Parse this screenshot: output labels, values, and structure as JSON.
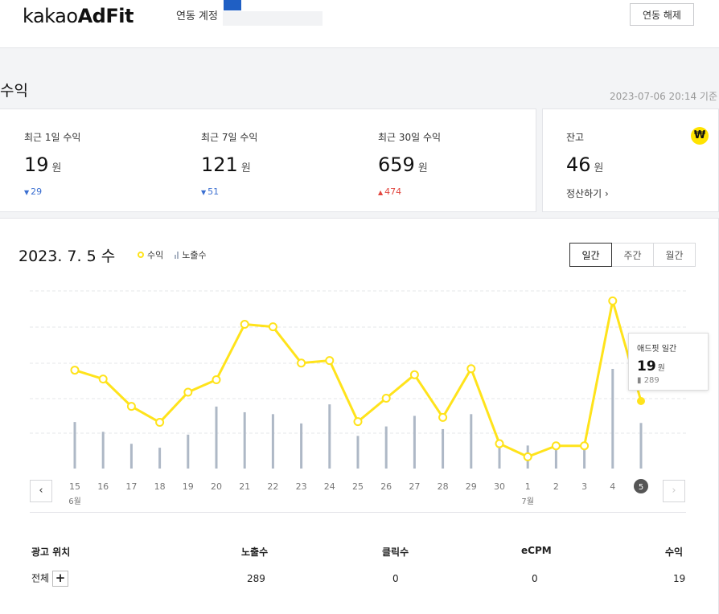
{
  "header": {
    "logo_prefix": "kakao",
    "logo_bold": "AdFit",
    "account_label": "연동 계정",
    "unlink_label": "연동 해제"
  },
  "section": {
    "title": "수익",
    "timestamp": "2023-07-06 20:14 기준"
  },
  "summary": [
    {
      "label": "최근 1일 수익",
      "value": "19",
      "unit": "원",
      "delta": "29",
      "direction": "down"
    },
    {
      "label": "최근 7일 수익",
      "value": "121",
      "unit": "원",
      "delta": "51",
      "direction": "down"
    },
    {
      "label": "최근 30일 수익",
      "value": "659",
      "unit": "원",
      "delta": "474",
      "direction": "up"
    }
  ],
  "balance": {
    "label": "잔고",
    "value": "46",
    "unit": "원",
    "settle_label": "정산하기",
    "badge_glyph": "₩"
  },
  "chart_header": {
    "date": "2023. 7. 5 수",
    "legend_revenue": "수익",
    "legend_impressions": "노출수",
    "periods": [
      "일간",
      "주간",
      "월간"
    ],
    "active_period": 0
  },
  "tooltip": {
    "title": "애드핏 일간",
    "value": "19",
    "unit": "원",
    "impressions": "289"
  },
  "chart_data": {
    "type": "line",
    "x": [
      "15",
      "16",
      "17",
      "18",
      "19",
      "20",
      "21",
      "22",
      "23",
      "24",
      "25",
      "26",
      "27",
      "28",
      "29",
      "30",
      "1",
      "2",
      "3",
      "4",
      "5"
    ],
    "month_labels": [
      {
        "index": 0,
        "label": "6월"
      },
      {
        "index": 16,
        "label": "7월"
      }
    ],
    "selected_index": 20,
    "series": [
      {
        "name": "수익",
        "kind": "line",
        "values": [
          27.7,
          25.2,
          17.5,
          13.0,
          21.5,
          25.0,
          40.6,
          39.9,
          29.7,
          30.4,
          13.2,
          19.8,
          26.4,
          14.4,
          28.1,
          7.0,
          3.3,
          6.4,
          6.4,
          47.2,
          19
        ]
      },
      {
        "name": "노출수",
        "kind": "bar",
        "values": [
          295,
          233,
          157,
          132,
          215,
          393,
          357,
          345,
          286,
          407,
          207,
          267,
          334,
          250,
          345,
          146,
          146,
          146,
          146,
          632,
          289
        ]
      }
    ],
    "colors": {
      "line": "#ffe31b",
      "bar": "#aeb8c6",
      "grid": "#e6e7ea"
    }
  },
  "table": {
    "headers": [
      "광고 위치",
      "노출수",
      "클릭수",
      "eCPM",
      "수익"
    ],
    "rows": [
      [
        "전체",
        "289",
        "0",
        "0",
        "19"
      ]
    ],
    "expand_glyph": "+"
  },
  "nav": {
    "prev": "‹",
    "next": "›"
  }
}
